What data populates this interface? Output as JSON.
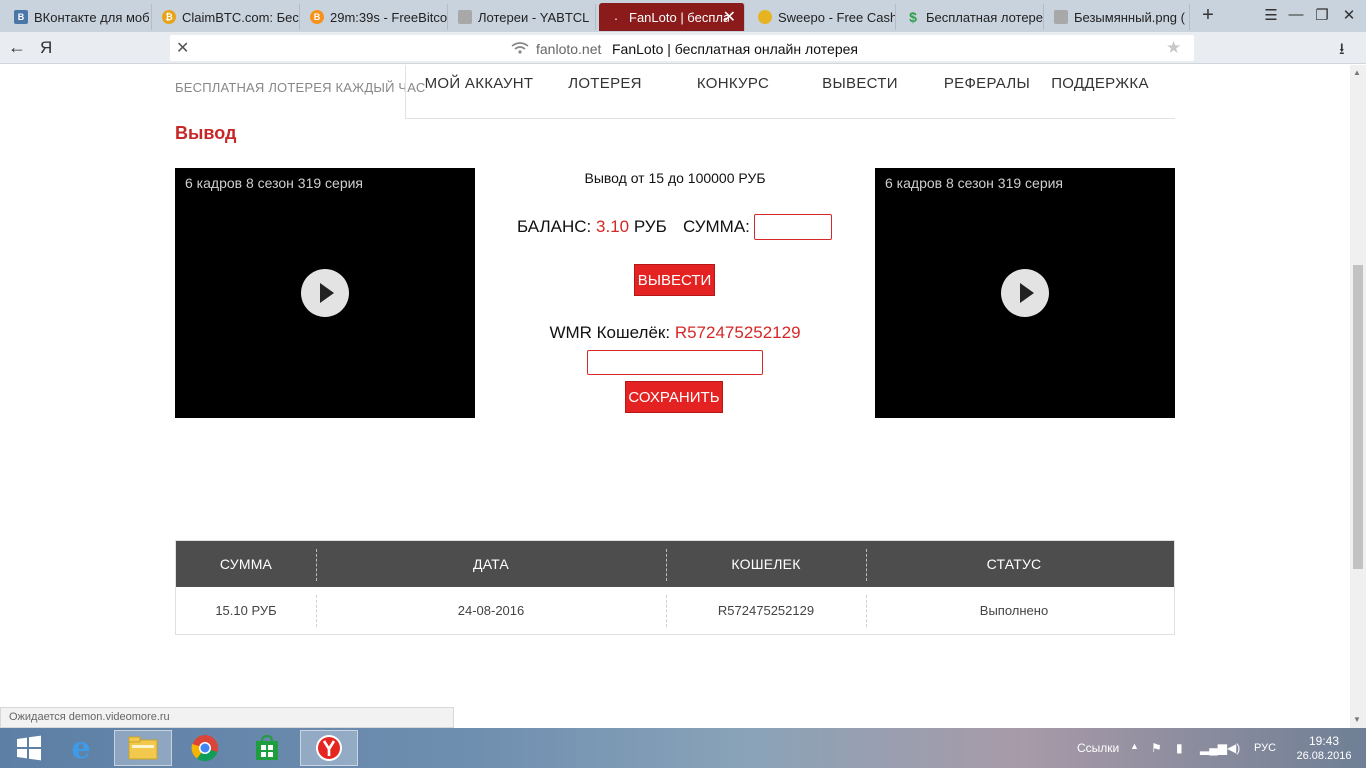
{
  "browser": {
    "tabs": [
      {
        "title": "ВКонтакте для моб",
        "favicon": "vk-icon",
        "color": "#4a76a8",
        "active": false
      },
      {
        "title": "ClaimBTC.com: Бес",
        "favicon": "coin-icon",
        "color": "#e8a317",
        "active": false
      },
      {
        "title": "29m:39s - FreeBitco",
        "favicon": "bitcoin-icon",
        "color": "#f7931a",
        "active": false
      },
      {
        "title": "Лотереи - YABTCL",
        "favicon": "page-icon",
        "color": "#a8a8a8",
        "active": false
      },
      {
        "title": "FanLoto | беспла",
        "favicon": "page-icon",
        "color": "#8b1b1b",
        "active": true
      },
      {
        "title": "Sweepo - Free Cash",
        "favicon": "coins-icon",
        "color": "#e6b422",
        "active": false
      },
      {
        "title": "Бесплатная лотере",
        "favicon": "dollar-icon",
        "color": "#2e9e4a",
        "active": false
      },
      {
        "title": "Безымянный.png (",
        "favicon": "page-icon",
        "color": "#a8a8a8",
        "active": false
      }
    ],
    "newtab_label": "+",
    "address": {
      "domain": "fanloto.net",
      "title": "FanLoto | бесплатная онлайн лотерея"
    },
    "status_text": "Ожидается demon.videomore.ru"
  },
  "site": {
    "slogan": "БЕСПЛАТНАЯ ЛОТЕРЕЯ КАЖДЫЙ ЧАС",
    "nav": [
      "МОЙ АККАУНТ",
      "ЛОТЕРЕЯ",
      "КОНКУРС",
      "ВЫВЕСТИ",
      "РЕФЕРАЛЫ",
      "ПОДДЕРЖКА"
    ],
    "section_title": "Вывод",
    "video_left_title": "6 кадров 8 сезон 319 серия",
    "video_right_title": "6 кадров 8 сезон 319 серия",
    "withdraw": {
      "range_text": "Вывод от 15 до 100000 РУБ",
      "balance_label": "БАЛАНС:",
      "balance_value": "3.10",
      "balance_currency": "РУБ",
      "amount_label": "СУММА:",
      "amount_value": "",
      "withdraw_button": "ВЫВЕСТИ",
      "wallet_label": "WMR Кошелёк:",
      "wallet_value": "R572475252129",
      "wallet_input_value": "",
      "save_button": "СОХРАНИТЬ"
    },
    "history": {
      "columns": [
        "СУММА",
        "ДАТА",
        "КОШЕЛЕК",
        "СТАТУС"
      ],
      "rows": [
        {
          "amount": "15.10 РУБ",
          "date": "24-08-2016",
          "wallet": "R572475252129",
          "status": "Выполнено"
        }
      ]
    },
    "accent_color": "#d62828"
  },
  "taskbar": {
    "links_label": "Ссылки",
    "language": "РУС",
    "time": "19:43",
    "date": "26.08.2016"
  }
}
